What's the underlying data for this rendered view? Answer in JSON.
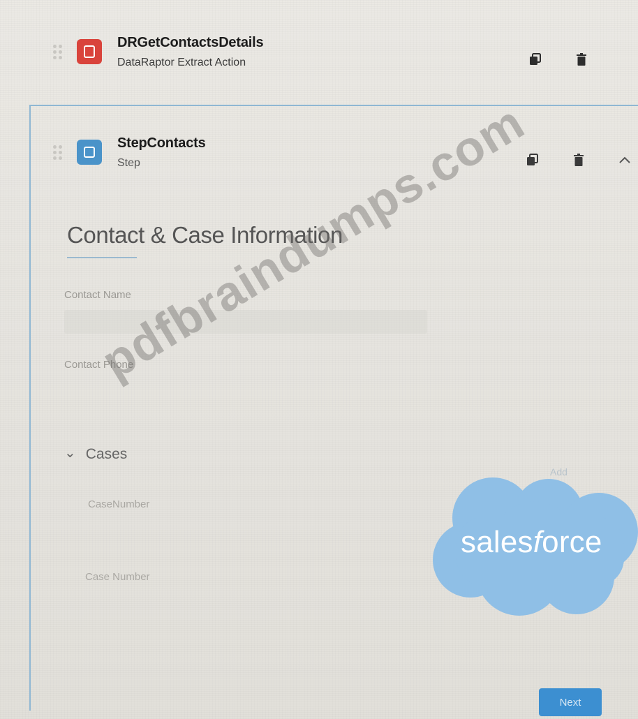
{
  "elements": {
    "dataraptor": {
      "title": "DRGetContactsDetails",
      "subtitle": "DataRaptor Extract Action",
      "icon": "dataraptor-icon",
      "icon_color": "#d9433b"
    },
    "step": {
      "title": "StepContacts",
      "subtitle": "Step",
      "icon": "step-icon",
      "icon_color": "#4a93c9"
    }
  },
  "actions": {
    "copy_icon": "copy-icon",
    "delete_icon": "trash-icon",
    "collapse_icon": "chevron-up-icon"
  },
  "form": {
    "section_title": "Contact & Case Information",
    "contact_name_label": "Contact Name",
    "contact_phone_label": "Contact Phone",
    "cases_label": "Cases",
    "add_label": "Add",
    "case_number_label": "CaseNumber",
    "case_number_label_2": "Case Number",
    "next_label": "Next"
  },
  "branding": {
    "logo_text_plain": "sales",
    "logo_text_italic": "f",
    "logo_text_end": "orce",
    "logo_color": "#8fbfe6"
  },
  "watermark": "pdfbraindumps.com"
}
